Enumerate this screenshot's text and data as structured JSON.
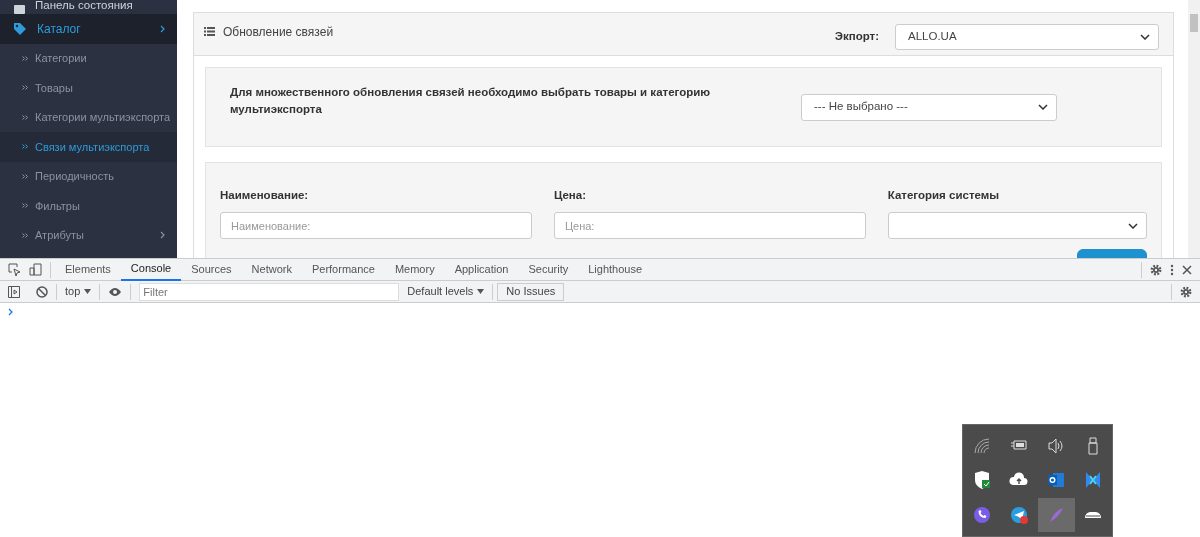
{
  "sidebar": {
    "items": [
      {
        "label": "Панель состояния",
        "kind": "dashboard",
        "expanded": false
      },
      {
        "label": "Каталог",
        "kind": "tag",
        "expanded": true,
        "children": [
          {
            "label": "Категории",
            "selected": false,
            "expandable": false
          },
          {
            "label": "Товары",
            "selected": false,
            "expandable": false
          },
          {
            "label": "Категории мультиэкспорта",
            "selected": false,
            "expandable": false
          },
          {
            "label": "Связи мультиэкспорта",
            "selected": true,
            "expandable": false
          },
          {
            "label": "Периодичность",
            "selected": false,
            "expandable": false
          },
          {
            "label": "Фильтры",
            "selected": false,
            "expandable": false
          },
          {
            "label": "Атрибуты",
            "selected": false,
            "expandable": true
          }
        ]
      }
    ]
  },
  "panel": {
    "title": "Обновление связей",
    "export_label": "Экпорт:",
    "export_value": "ALLO.UA",
    "bulk": {
      "text": "Для множественного обновления связей необходимо выбрать товары и категорию мультиэкспорта",
      "select_value": "--- Не выбрано ---"
    },
    "filters": [
      {
        "kind": "input",
        "label": "Наименование:",
        "placeholder": "Наименование:"
      },
      {
        "kind": "input",
        "label": "Цена:",
        "placeholder": "Цена:"
      },
      {
        "kind": "select",
        "label": "Категория системы"
      }
    ]
  },
  "devtools": {
    "tabs": [
      {
        "label": "Elements",
        "selected": false
      },
      {
        "label": "Console",
        "selected": true
      },
      {
        "label": "Sources",
        "selected": false
      },
      {
        "label": "Network",
        "selected": false
      },
      {
        "label": "Performance",
        "selected": false
      },
      {
        "label": "Memory",
        "selected": false
      },
      {
        "label": "Application",
        "selected": false
      },
      {
        "label": "Security",
        "selected": false
      },
      {
        "label": "Lighthouse",
        "selected": false
      }
    ],
    "context": "top",
    "filter_placeholder": "Filter",
    "levels": "Default levels",
    "issues": "No Issues"
  },
  "tray": {
    "icons": [
      {
        "kind": "wifi",
        "selected": false
      },
      {
        "kind": "battery",
        "selected": false
      },
      {
        "kind": "speaker",
        "selected": false
      },
      {
        "kind": "usb",
        "selected": false
      },
      {
        "kind": "shield",
        "selected": false
      },
      {
        "kind": "cloud",
        "selected": false
      },
      {
        "kind": "mail",
        "selected": false
      },
      {
        "kind": "cross",
        "selected": false
      },
      {
        "kind": "phone",
        "selected": false
      },
      {
        "kind": "plane",
        "selected": false
      },
      {
        "kind": "feather",
        "selected": true
      },
      {
        "kind": "car",
        "selected": false
      }
    ]
  }
}
